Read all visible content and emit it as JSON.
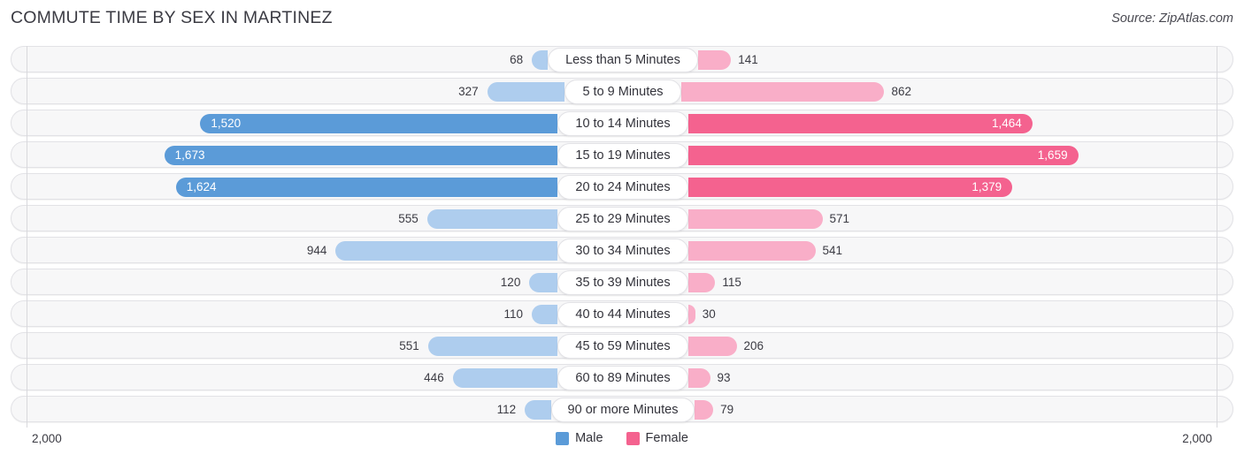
{
  "header": {
    "title": "COMMUTE TIME BY SEX IN MARTINEZ",
    "source": "Source: ZipAtlas.com"
  },
  "axis": {
    "left_tick": "2,000",
    "right_tick": "2,000"
  },
  "legend": [
    {
      "label": "Male",
      "color": "#5b9bd8"
    },
    {
      "label": "Female",
      "color": "#f4628f"
    }
  ],
  "colors": {
    "male_light": "#aecdee",
    "male_dark": "#5b9bd8",
    "female_light": "#f9aec8",
    "female_dark": "#f4628f",
    "row_track": "#f7f7f8",
    "row_border": "#e2e2e6",
    "text": "#33333b"
  },
  "chart_data": {
    "type": "bar",
    "title": "COMMUTE TIME BY SEX IN MARTINEZ",
    "subtitle": "Source: ZipAtlas.com",
    "orientation": "horizontal-diverging",
    "xlabel": "",
    "ylabel": "",
    "xlim": [
      2000,
      2000
    ],
    "grid": false,
    "legend_position": "bottom-center",
    "categories": [
      "Less than 5 Minutes",
      "5 to 9 Minutes",
      "10 to 14 Minutes",
      "15 to 19 Minutes",
      "20 to 24 Minutes",
      "25 to 29 Minutes",
      "30 to 34 Minutes",
      "35 to 39 Minutes",
      "40 to 44 Minutes",
      "45 to 59 Minutes",
      "60 to 89 Minutes",
      "90 or more Minutes"
    ],
    "series": [
      {
        "name": "Male",
        "values": [
          68,
          327,
          1520,
          1673,
          1624,
          555,
          944,
          120,
          110,
          551,
          446,
          112
        ],
        "labels": [
          "68",
          "327",
          "1,520",
          "1,673",
          "1,624",
          "555",
          "944",
          "120",
          "110",
          "551",
          "446",
          "112"
        ]
      },
      {
        "name": "Female",
        "values": [
          141,
          862,
          1464,
          1659,
          1379,
          571,
          541,
          115,
          30,
          206,
          93,
          79
        ],
        "labels": [
          "141",
          "862",
          "1,464",
          "1,659",
          "1,379",
          "571",
          "541",
          "115",
          "30",
          "206",
          "93",
          "79"
        ]
      }
    ]
  },
  "rows": [
    {
      "category": "Less than 5 Minutes",
      "male": 68,
      "male_label": "68",
      "female": 141,
      "female_label": "141"
    },
    {
      "category": "5 to 9 Minutes",
      "male": 327,
      "male_label": "327",
      "female": 862,
      "female_label": "862"
    },
    {
      "category": "10 to 14 Minutes",
      "male": 1520,
      "male_label": "1,520",
      "female": 1464,
      "female_label": "1,464"
    },
    {
      "category": "15 to 19 Minutes",
      "male": 1673,
      "male_label": "1,673",
      "female": 1659,
      "female_label": "1,659"
    },
    {
      "category": "20 to 24 Minutes",
      "male": 1624,
      "male_label": "1,624",
      "female": 1379,
      "female_label": "1,379"
    },
    {
      "category": "25 to 29 Minutes",
      "male": 555,
      "male_label": "555",
      "female": 571,
      "female_label": "571"
    },
    {
      "category": "30 to 34 Minutes",
      "male": 944,
      "male_label": "944",
      "female": 541,
      "female_label": "541"
    },
    {
      "category": "35 to 39 Minutes",
      "male": 120,
      "male_label": "120",
      "female": 115,
      "female_label": "115"
    },
    {
      "category": "40 to 44 Minutes",
      "male": 110,
      "male_label": "110",
      "female": 30,
      "female_label": "30"
    },
    {
      "category": "45 to 59 Minutes",
      "male": 551,
      "male_label": "551",
      "female": 206,
      "female_label": "206"
    },
    {
      "category": "60 to 89 Minutes",
      "male": 446,
      "male_label": "446",
      "female": 93,
      "female_label": "93"
    },
    {
      "category": "90 or more Minutes",
      "male": 112,
      "male_label": "112",
      "female": 79,
      "female_label": "79"
    }
  ]
}
